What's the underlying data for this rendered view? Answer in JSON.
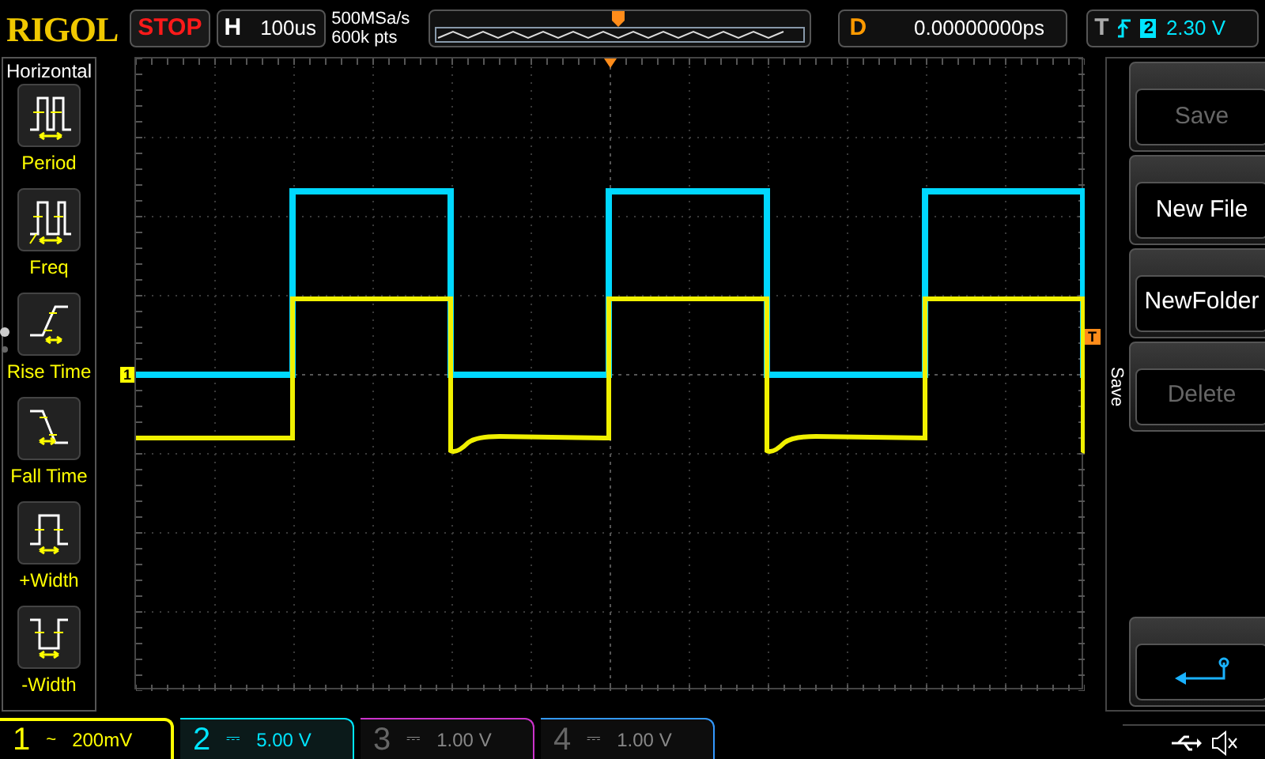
{
  "brand": "RIGOL",
  "run_state": "STOP",
  "timebase": {
    "label": "H",
    "value": "100us"
  },
  "acquisition": [
    "500MSa/s",
    "600k pts"
  ],
  "delay": {
    "label": "D",
    "value": "0.00000000ps"
  },
  "trigger": {
    "label": "T",
    "source": "2",
    "level": "2.30 V"
  },
  "measure_menu": {
    "title": "Horizontal",
    "items": [
      {
        "kind": "period",
        "label": "Period"
      },
      {
        "kind": "freq",
        "label": "Freq"
      },
      {
        "kind": "rise",
        "label": "Rise Time"
      },
      {
        "kind": "fall",
        "label": "Fall Time"
      },
      {
        "kind": "pwidth",
        "label": "+Width"
      },
      {
        "kind": "nwidth",
        "label": "-Width"
      }
    ]
  },
  "markers": {
    "channel": "1",
    "trigger": "T"
  },
  "softkey_menu": {
    "title": "Save",
    "items": [
      {
        "kind": "text",
        "label": "Save",
        "disabled": true
      },
      {
        "kind": "text",
        "label": "New File",
        "disabled": false
      },
      {
        "kind": "text",
        "label": "NewFolder",
        "disabled": false
      },
      {
        "kind": "text",
        "label": "Delete",
        "disabled": true
      },
      {
        "kind": "empty"
      },
      {
        "kind": "back"
      }
    ]
  },
  "channels": [
    {
      "number": "1",
      "coupling": "~",
      "scale": "200mV",
      "on": true,
      "color": "#ffff00"
    },
    {
      "number": "2",
      "coupling": "⎓",
      "scale": "5.00 V",
      "on": true,
      "color": "#00e5ff"
    },
    {
      "number": "3",
      "coupling": "⎓",
      "scale": "1.00 V",
      "on": false,
      "color": "#cc33cc"
    },
    {
      "number": "4",
      "coupling": "⎓",
      "scale": "1.00 V",
      "on": false,
      "color": "#3399ff"
    }
  ]
}
